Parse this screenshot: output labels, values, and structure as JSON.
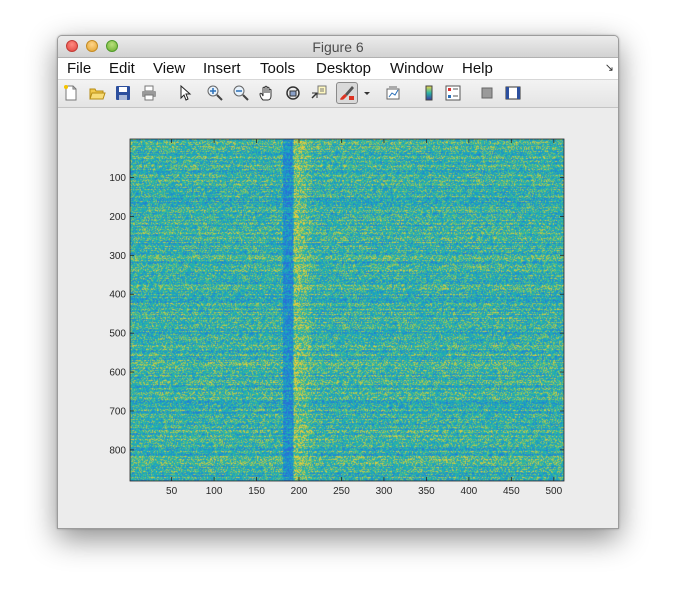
{
  "window": {
    "title": "Figure 6"
  },
  "menubar": {
    "items": [
      "File",
      "Edit",
      "View",
      "Insert",
      "Tools",
      "Desktop",
      "Window",
      "Help"
    ]
  },
  "toolbar": {
    "icons": [
      "new-figure-icon",
      "open-file-icon",
      "save-icon",
      "print-icon",
      "pointer-icon",
      "zoom-in-icon",
      "zoom-out-icon",
      "pan-hand-icon",
      "rotate-3d-icon",
      "data-cursor-icon",
      "brush-icon",
      "brush-dropdown-icon",
      "link-plot-icon",
      "colorbar-icon",
      "legend-icon",
      "hide-plot-tools-icon",
      "show-plot-tools-icon"
    ]
  },
  "chart_data": {
    "type": "heatmap",
    "title": "",
    "xlabel": "",
    "ylabel": "",
    "xlim": [
      1,
      512
    ],
    "ylim": [
      1,
      880
    ],
    "y_reversed": true,
    "x_ticks": [
      50,
      100,
      150,
      200,
      250,
      300,
      350,
      400,
      450,
      500
    ],
    "y_ticks": [
      100,
      200,
      300,
      400,
      500,
      600,
      700,
      800
    ],
    "colormap": "parula",
    "colors": {
      "low": "#1f8fd4",
      "mid": "#27b5a3",
      "high": "#d6c94a"
    },
    "features": [
      {
        "type": "vertical-band-low",
        "x_range": [
          180,
          192
        ]
      },
      {
        "type": "vertical-band-high",
        "x_range": [
          193,
          215
        ]
      }
    ]
  }
}
